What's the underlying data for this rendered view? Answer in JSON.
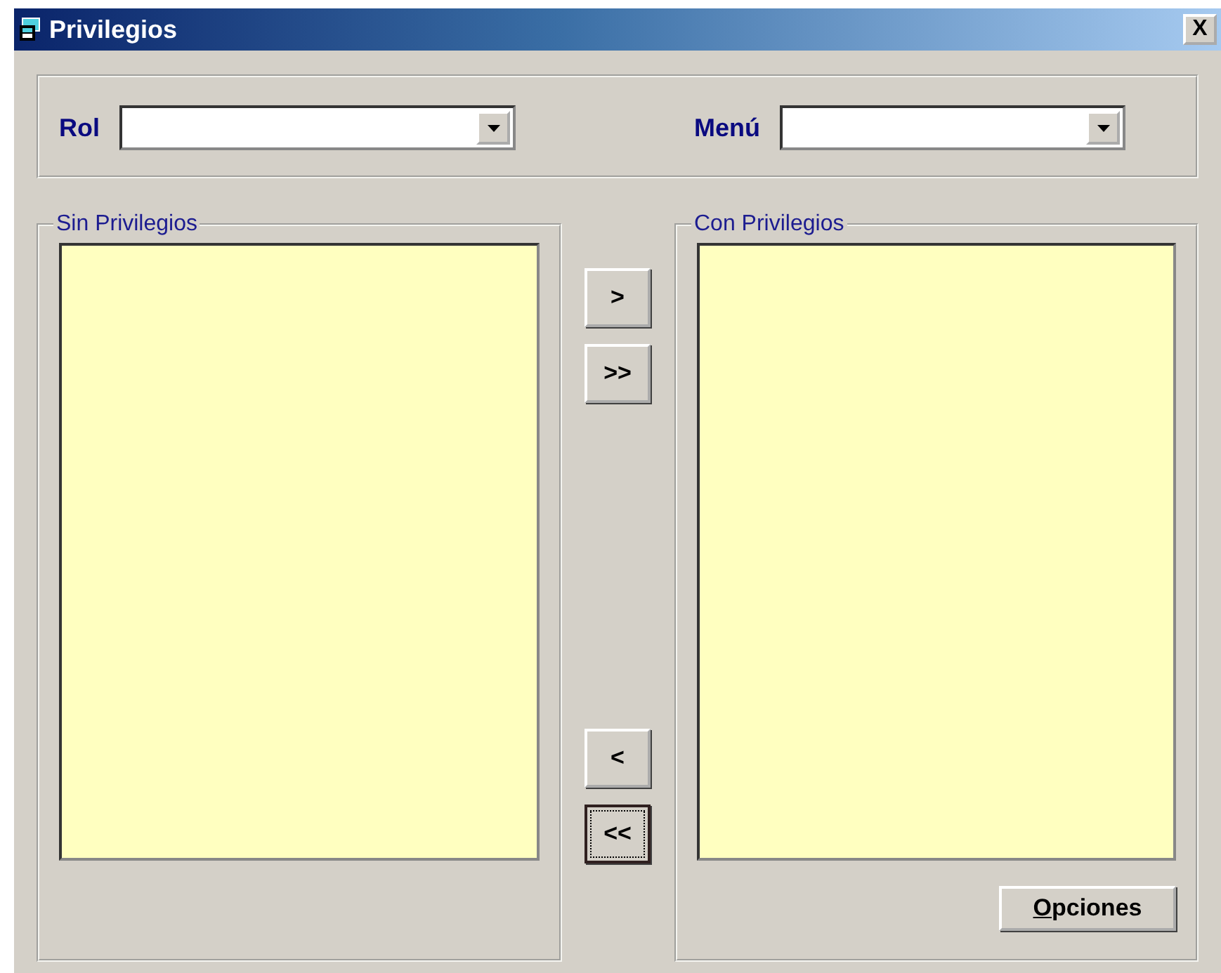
{
  "window": {
    "title": "Privilegios",
    "close": "X"
  },
  "filters": [
    {
      "label": "Rol"
    },
    {
      "label": "Menú"
    }
  ],
  "lists": [
    {
      "title": "Sin Privilegios"
    },
    {
      "title": "Con Privilegios"
    }
  ],
  "transfer_buttons": [
    {
      "label": ">",
      "focused": false
    },
    {
      "label": ">>",
      "focused": false
    },
    {
      "label": "<",
      "focused": false
    },
    {
      "label": "<<",
      "focused": true
    }
  ],
  "options_button": {
    "label": "Opciones",
    "access_key_underlined": true
  }
}
